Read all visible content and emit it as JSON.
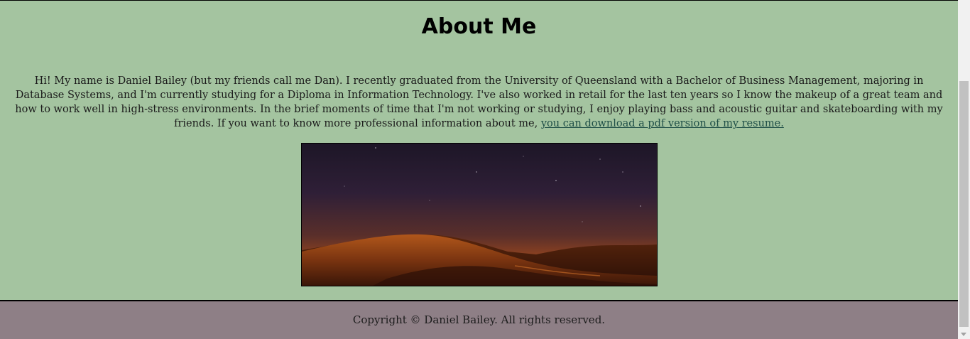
{
  "page": {
    "heading": "About Me",
    "bio": {
      "text": "Hi! My name is Daniel Bailey (but my friends call me Dan). I recently graduated from the University of Queensland with a Bachelor of Business Management, majoring in Database Systems, and I'm currently studying for a Diploma in Information Technology. I've also worked in retail for the last ten years so I know the makeup of a great team and how to work well in high-stress environments. In the brief moments of time that I'm not working or studying, I enjoy playing bass and acoustic guitar and skateboarding with my friends. If you want to know more professional information about me, ",
      "link_label": "you can download a pdf version of my resume."
    },
    "hero_image": {
      "icon": "desert-night-photo"
    }
  },
  "footer": {
    "copyright": "Copyright © Daniel Bailey. All rights reserved."
  },
  "colors": {
    "page_background": "#a4c4a0",
    "footer_background": "#8e7f86",
    "link": "#1f4f47"
  }
}
